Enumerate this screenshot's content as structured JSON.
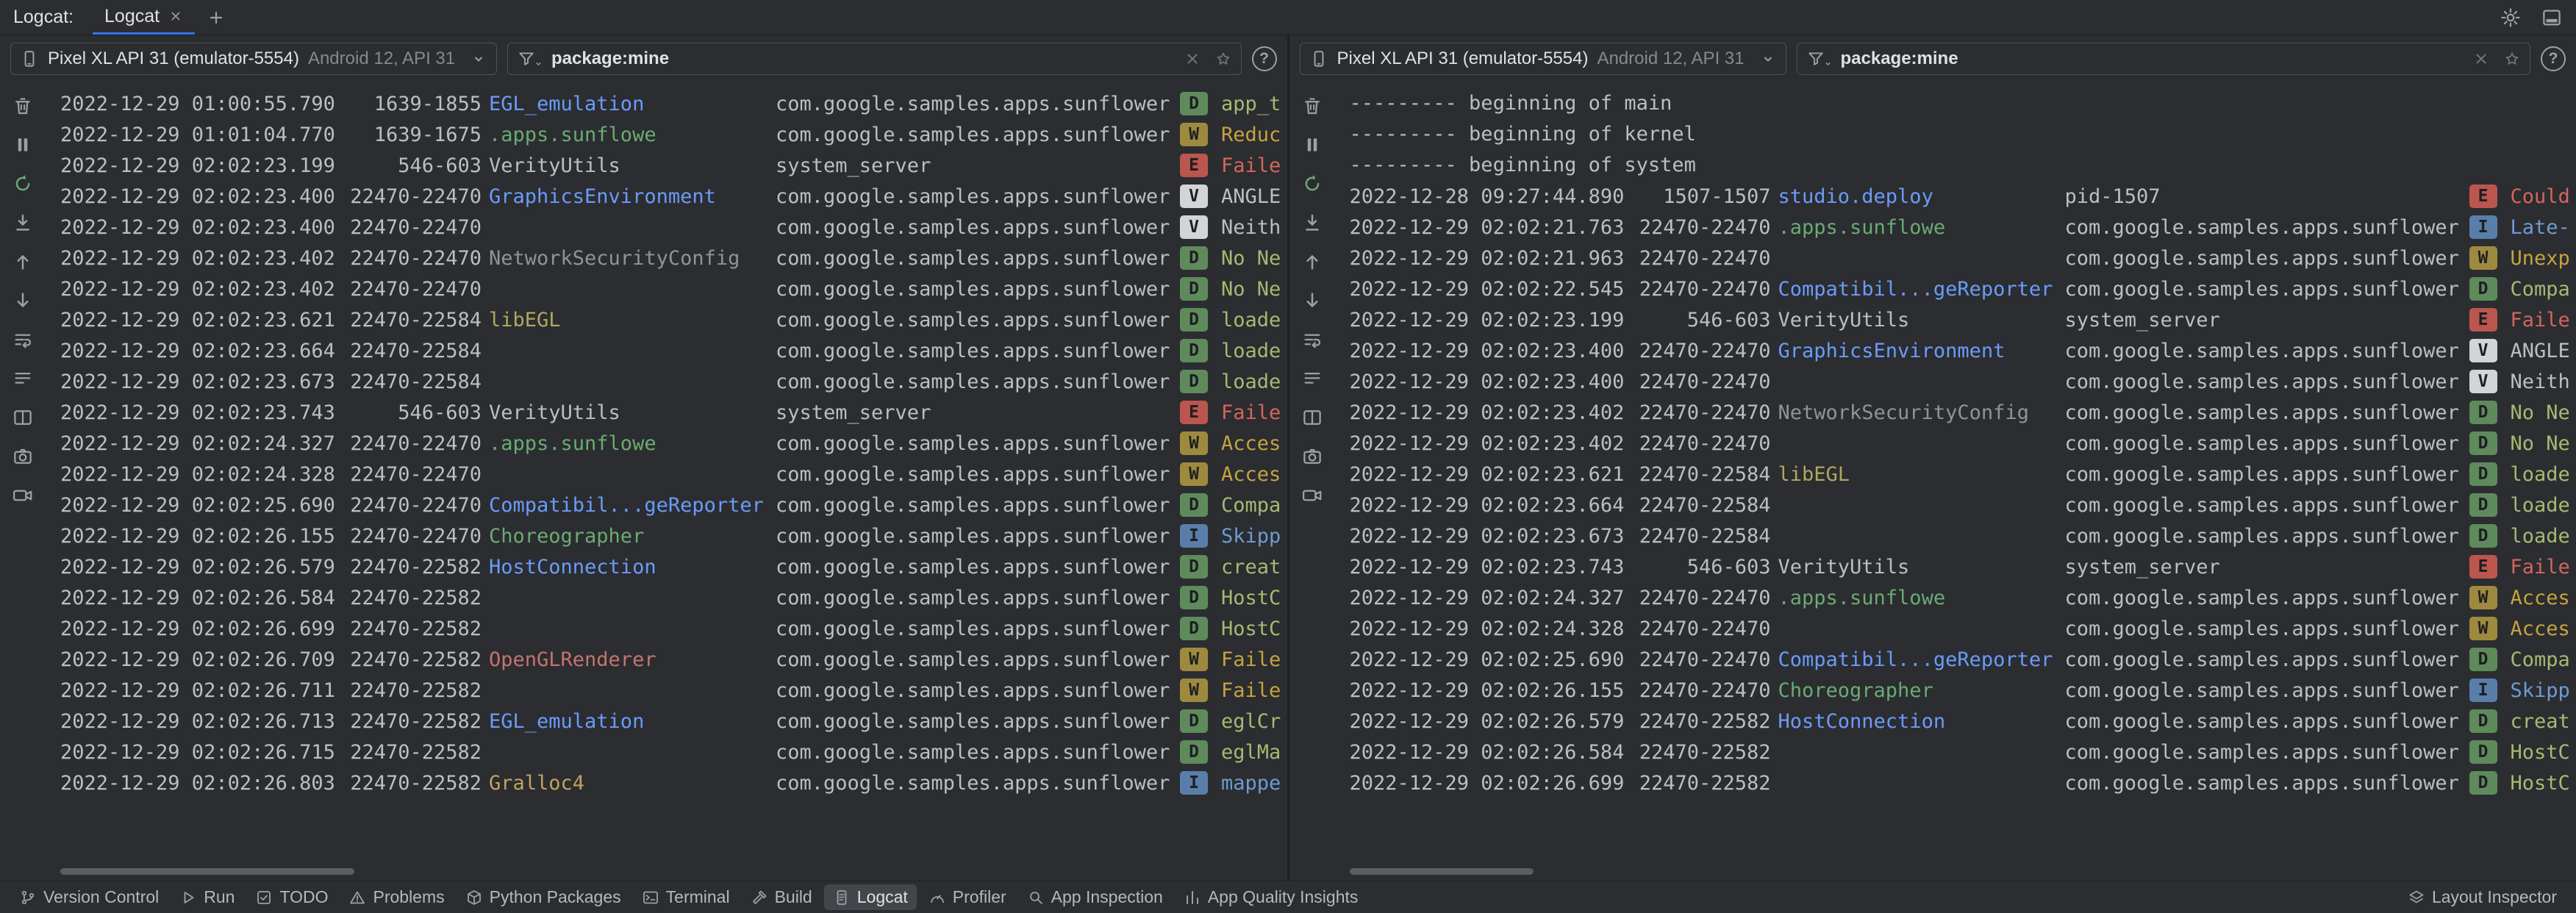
{
  "tabbar": {
    "tool_label": "Logcat:",
    "tabs": [
      {
        "label": "Logcat",
        "active": true
      }
    ]
  },
  "icons": {
    "help": "?",
    "settings": "gear",
    "hide": "hide-window",
    "new_tab": "plus",
    "tab_close": "x",
    "device": "phone",
    "filter": "funnel",
    "clear_filter": "x",
    "favorite_filter": "star",
    "dropdown": "chevron-down"
  },
  "side_toolbar": [
    {
      "name": "clear-logcat",
      "icon": "i-trash",
      "green": false
    },
    {
      "name": "pause-logcat",
      "icon": "i-pause",
      "green": false
    },
    {
      "name": "restart-logcat",
      "icon": "i-restart",
      "green": true
    },
    {
      "name": "scroll-to-end",
      "icon": "i-scrollend",
      "green": false
    },
    {
      "name": "previous-occurrence",
      "icon": "i-up",
      "green": false
    },
    {
      "name": "next-occurrence",
      "icon": "i-down",
      "green": false
    },
    {
      "name": "soft-wrap",
      "icon": "i-wrap",
      "green": false
    },
    {
      "name": "logcat-formatting",
      "icon": "i-format",
      "green": false
    },
    {
      "name": "split-panels",
      "icon": "i-split",
      "green": false
    },
    {
      "name": "screenshot",
      "icon": "i-camera",
      "green": false
    },
    {
      "name": "screen-record",
      "icon": "i-video",
      "green": false
    }
  ],
  "log_colors": {
    "timestamp": "#bcbec4",
    "package": "#bcbec4",
    "separator": "#bcbec4",
    "default_tag": "#bcbec4",
    "badge_text": "#1e1f22",
    "accent": "#3574f0",
    "levels": {
      "V": {
        "badge": "#d2d4d8",
        "msg": "#bcbec4"
      },
      "D": {
        "badge": "#5e8a5c",
        "msg": "#a8b872"
      },
      "I": {
        "badge": "#597eaa",
        "msg": "#6e9bd3"
      },
      "W": {
        "badge": "#9e8a3e",
        "msg": "#c6a33e"
      },
      "E": {
        "badge": "#bb564e",
        "msg": "#d3655c"
      }
    },
    "tags": {
      "EGL_emulation": "#6b9bfa",
      ".apps.sunflowe": "#6aab73",
      "VerityUtils": "#bcbec4",
      "GraphicsEnvironment": "#6b9bfa",
      "NetworkSecurityConfig": "#8f9499",
      "libEGL": "#b0a762",
      "Compatibil...geReporter": "#6b9bfa",
      "Choreographer": "#6aab73",
      "HostConnection": "#6b9bfa",
      "OpenGLRenderer": "#c4746e",
      "Gralloc4": "#c2a35e",
      "studio.deploy": "#6b9bfa"
    }
  },
  "panels": [
    {
      "device": {
        "name": "Pixel XL API 31 (emulator-5554)",
        "details": "Android 12, API 31"
      },
      "filter": {
        "value": "package:mine"
      },
      "rows": [
        {
          "t": "2022-12-29 01:00:55.790",
          "p": "1639-1855",
          "tag": "EGL_emulation",
          "app": "com.google.samples.apps.sunflower",
          "lv": "D",
          "m": "app_t"
        },
        {
          "t": "2022-12-29 01:01:04.770",
          "p": "1639-1675",
          "tag": ".apps.sunflowe",
          "app": "com.google.samples.apps.sunflower",
          "lv": "W",
          "m": "Reduc"
        },
        {
          "t": "2022-12-29 02:02:23.199",
          "p": "546-603",
          "tag": "VerityUtils",
          "app": "system_server",
          "lv": "E",
          "m": "Faile"
        },
        {
          "t": "2022-12-29 02:02:23.400",
          "p": "22470-22470",
          "tag": "GraphicsEnvironment",
          "app": "com.google.samples.apps.sunflower",
          "lv": "V",
          "m": "ANGLE"
        },
        {
          "t": "2022-12-29 02:02:23.400",
          "p": "22470-22470",
          "tag": "",
          "app": "com.google.samples.apps.sunflower",
          "lv": "V",
          "m": "Neith"
        },
        {
          "t": "2022-12-29 02:02:23.402",
          "p": "22470-22470",
          "tag": "NetworkSecurityConfig",
          "app": "com.google.samples.apps.sunflower",
          "lv": "D",
          "m": "No Ne"
        },
        {
          "t": "2022-12-29 02:02:23.402",
          "p": "22470-22470",
          "tag": "",
          "app": "com.google.samples.apps.sunflower",
          "lv": "D",
          "m": "No Ne"
        },
        {
          "t": "2022-12-29 02:02:23.621",
          "p": "22470-22584",
          "tag": "libEGL",
          "app": "com.google.samples.apps.sunflower",
          "lv": "D",
          "m": "loade"
        },
        {
          "t": "2022-12-29 02:02:23.664",
          "p": "22470-22584",
          "tag": "",
          "app": "com.google.samples.apps.sunflower",
          "lv": "D",
          "m": "loade"
        },
        {
          "t": "2022-12-29 02:02:23.673",
          "p": "22470-22584",
          "tag": "",
          "app": "com.google.samples.apps.sunflower",
          "lv": "D",
          "m": "loade"
        },
        {
          "t": "2022-12-29 02:02:23.743",
          "p": "546-603",
          "tag": "VerityUtils",
          "app": "system_server",
          "lv": "E",
          "m": "Faile"
        },
        {
          "t": "2022-12-29 02:02:24.327",
          "p": "22470-22470",
          "tag": ".apps.sunflowe",
          "app": "com.google.samples.apps.sunflower",
          "lv": "W",
          "m": "Acces"
        },
        {
          "t": "2022-12-29 02:02:24.328",
          "p": "22470-22470",
          "tag": "",
          "app": "com.google.samples.apps.sunflower",
          "lv": "W",
          "m": "Acces"
        },
        {
          "t": "2022-12-29 02:02:25.690",
          "p": "22470-22470",
          "tag": "Compatibil...geReporter",
          "app": "com.google.samples.apps.sunflower",
          "lv": "D",
          "m": "Compa"
        },
        {
          "t": "2022-12-29 02:02:26.155",
          "p": "22470-22470",
          "tag": "Choreographer",
          "app": "com.google.samples.apps.sunflower",
          "lv": "I",
          "m": "Skipp"
        },
        {
          "t": "2022-12-29 02:02:26.579",
          "p": "22470-22582",
          "tag": "HostConnection",
          "app": "com.google.samples.apps.sunflower",
          "lv": "D",
          "m": "creat"
        },
        {
          "t": "2022-12-29 02:02:26.584",
          "p": "22470-22582",
          "tag": "",
          "app": "com.google.samples.apps.sunflower",
          "lv": "D",
          "m": "HostC"
        },
        {
          "t": "2022-12-29 02:02:26.699",
          "p": "22470-22582",
          "tag": "",
          "app": "com.google.samples.apps.sunflower",
          "lv": "D",
          "m": "HostC"
        },
        {
          "t": "2022-12-29 02:02:26.709",
          "p": "22470-22582",
          "tag": "OpenGLRenderer",
          "app": "com.google.samples.apps.sunflower",
          "lv": "W",
          "m": "Faile"
        },
        {
          "t": "2022-12-29 02:02:26.711",
          "p": "22470-22582",
          "tag": "",
          "app": "com.google.samples.apps.sunflower",
          "lv": "W",
          "m": "Faile"
        },
        {
          "t": "2022-12-29 02:02:26.713",
          "p": "22470-22582",
          "tag": "EGL_emulation",
          "app": "com.google.samples.apps.sunflower",
          "lv": "D",
          "m": "eglCr"
        },
        {
          "t": "2022-12-29 02:02:26.715",
          "p": "22470-22582",
          "tag": "",
          "app": "com.google.samples.apps.sunflower",
          "lv": "D",
          "m": "eglMa"
        },
        {
          "t": "2022-12-29 02:02:26.803",
          "p": "22470-22582",
          "tag": "Gralloc4",
          "app": "com.google.samples.apps.sunflower",
          "lv": "I",
          "m": "mappe"
        }
      ]
    },
    {
      "device": {
        "name": "Pixel XL API 31 (emulator-5554)",
        "details": "Android 12, API 31"
      },
      "filter": {
        "value": "package:mine"
      },
      "rows": [
        {
          "sep": "--------- beginning of main"
        },
        {
          "sep": "--------- beginning of kernel"
        },
        {
          "sep": "--------- beginning of system"
        },
        {
          "t": "2022-12-28 09:27:44.890",
          "p": "1507-1507",
          "tag": "studio.deploy",
          "app": "pid-1507",
          "lv": "E",
          "m": "Could"
        },
        {
          "t": "2022-12-29 02:02:21.763",
          "p": "22470-22470",
          "tag": ".apps.sunflowe",
          "app": "com.google.samples.apps.sunflower",
          "lv": "I",
          "m": "Late-"
        },
        {
          "t": "2022-12-29 02:02:21.963",
          "p": "22470-22470",
          "tag": "",
          "app": "com.google.samples.apps.sunflower",
          "lv": "W",
          "m": "Unexp"
        },
        {
          "t": "2022-12-29 02:02:22.545",
          "p": "22470-22470",
          "tag": "Compatibil...geReporter",
          "app": "com.google.samples.apps.sunflower",
          "lv": "D",
          "m": "Compa"
        },
        {
          "t": "2022-12-29 02:02:23.199",
          "p": "546-603",
          "tag": "VerityUtils",
          "app": "system_server",
          "lv": "E",
          "m": "Faile"
        },
        {
          "t": "2022-12-29 02:02:23.400",
          "p": "22470-22470",
          "tag": "GraphicsEnvironment",
          "app": "com.google.samples.apps.sunflower",
          "lv": "V",
          "m": "ANGLE"
        },
        {
          "t": "2022-12-29 02:02:23.400",
          "p": "22470-22470",
          "tag": "",
          "app": "com.google.samples.apps.sunflower",
          "lv": "V",
          "m": "Neith"
        },
        {
          "t": "2022-12-29 02:02:23.402",
          "p": "22470-22470",
          "tag": "NetworkSecurityConfig",
          "app": "com.google.samples.apps.sunflower",
          "lv": "D",
          "m": "No Ne"
        },
        {
          "t": "2022-12-29 02:02:23.402",
          "p": "22470-22470",
          "tag": "",
          "app": "com.google.samples.apps.sunflower",
          "lv": "D",
          "m": "No Ne"
        },
        {
          "t": "2022-12-29 02:02:23.621",
          "p": "22470-22584",
          "tag": "libEGL",
          "app": "com.google.samples.apps.sunflower",
          "lv": "D",
          "m": "loade"
        },
        {
          "t": "2022-12-29 02:02:23.664",
          "p": "22470-22584",
          "tag": "",
          "app": "com.google.samples.apps.sunflower",
          "lv": "D",
          "m": "loade"
        },
        {
          "t": "2022-12-29 02:02:23.673",
          "p": "22470-22584",
          "tag": "",
          "app": "com.google.samples.apps.sunflower",
          "lv": "D",
          "m": "loade"
        },
        {
          "t": "2022-12-29 02:02:23.743",
          "p": "546-603",
          "tag": "VerityUtils",
          "app": "system_server",
          "lv": "E",
          "m": "Faile"
        },
        {
          "t": "2022-12-29 02:02:24.327",
          "p": "22470-22470",
          "tag": ".apps.sunflowe",
          "app": "com.google.samples.apps.sunflower",
          "lv": "W",
          "m": "Acces"
        },
        {
          "t": "2022-12-29 02:02:24.328",
          "p": "22470-22470",
          "tag": "",
          "app": "com.google.samples.apps.sunflower",
          "lv": "W",
          "m": "Acces"
        },
        {
          "t": "2022-12-29 02:02:25.690",
          "p": "22470-22470",
          "tag": "Compatibil...geReporter",
          "app": "com.google.samples.apps.sunflower",
          "lv": "D",
          "m": "Compa"
        },
        {
          "t": "2022-12-29 02:02:26.155",
          "p": "22470-22470",
          "tag": "Choreographer",
          "app": "com.google.samples.apps.sunflower",
          "lv": "I",
          "m": "Skipp"
        },
        {
          "t": "2022-12-29 02:02:26.579",
          "p": "22470-22582",
          "tag": "HostConnection",
          "app": "com.google.samples.apps.sunflower",
          "lv": "D",
          "m": "creat"
        },
        {
          "t": "2022-12-29 02:02:26.584",
          "p": "22470-22582",
          "tag": "",
          "app": "com.google.samples.apps.sunflower",
          "lv": "D",
          "m": "HostC"
        },
        {
          "t": "2022-12-29 02:02:26.699",
          "p": "22470-22582",
          "tag": "",
          "app": "com.google.samples.apps.sunflower",
          "lv": "D",
          "m": "HostC"
        }
      ]
    }
  ],
  "statusbar": {
    "active": "Logcat",
    "left": [
      {
        "label": "Version Control",
        "icon": "i-branch"
      },
      {
        "label": "Run",
        "icon": "i-run"
      },
      {
        "label": "TODO",
        "icon": "i-todo"
      },
      {
        "label": "Problems",
        "icon": "i-problems"
      },
      {
        "label": "Python Packages",
        "icon": "i-package"
      },
      {
        "label": "Terminal",
        "icon": "i-terminal"
      },
      {
        "label": "Build",
        "icon": "i-build"
      },
      {
        "label": "Logcat",
        "icon": "i-logcat"
      },
      {
        "label": "Profiler",
        "icon": "i-profiler"
      },
      {
        "label": "App Inspection",
        "icon": "i-inspect"
      },
      {
        "label": "App Quality Insights",
        "icon": "i-quality"
      }
    ],
    "right": [
      {
        "label": "Layout Inspector",
        "icon": "i-layers"
      }
    ]
  }
}
